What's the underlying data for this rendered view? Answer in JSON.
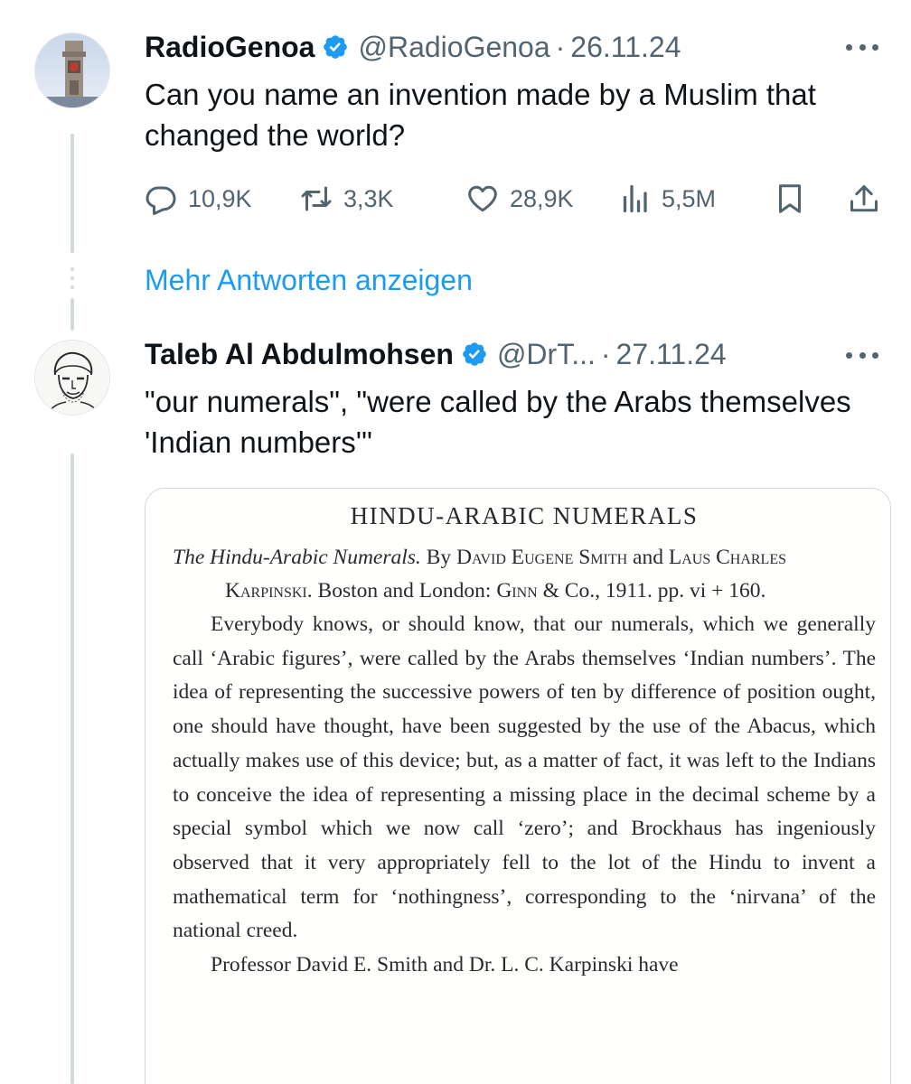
{
  "tweets": [
    {
      "name": "RadioGenoa",
      "handle": "@RadioGenoa",
      "separator": "·",
      "date": "26.11.24",
      "text": "Can you name an invention made by a Muslim that changed the world?",
      "stats": {
        "replies": "10,9K",
        "reposts": "3,3K",
        "likes": "28,9K",
        "views": "5,5M"
      }
    },
    {
      "name": "Taleb Al Abdulmohsen",
      "handle": "@DrT...",
      "separator": "·",
      "date": "27.11.24",
      "text": "\"our numerals\", \"were called by the Arabs themselves 'Indian numbers'\""
    }
  ],
  "more_replies_label": "Mehr Antworten anzeigen",
  "document": {
    "title": "HINDU-ARABIC NUMERALS",
    "ref_title": "The Hindu-Arabic Numerals.",
    "ref_by": "By",
    "ref_author1": "David Eugene Smith",
    "ref_and": "and",
    "ref_author2": "Laus Charles Karpinski.",
    "ref_place": "Boston and London:",
    "ref_publisher": "Ginn",
    "ref_rest": "& Co., 1911. pp. vi + 160.",
    "paragraph1": "Everybody knows, or should know, that our numerals, which we generally call ‘Arabic figures’, were called by the Arabs themselves ‘Indian numbers’. The idea of representing the successive powers of ten by difference of position ought, one should have thought, have been suggested by the use of the Abacus, which actually makes use of this device; but, as a matter of fact, it was left to the Indians to conceive the idea of representing a missing place in the decimal scheme by a special symbol which we now call ‘zero’; and Brockhaus has ingeniously observed that it very appropriately fell to the lot of the Hindu to invent a mathematical term for ‘nothingness’, corresponding to the ‘nirvana’ of the national creed.",
    "paragraph2": "Professor David E. Smith and Dr. L. C. Karpinski have"
  },
  "colors": {
    "accent": "#1d9bf0",
    "secondary_text": "#536471",
    "thread_line": "#cfd9de"
  },
  "icons": [
    "verified-badge-icon",
    "more-icon",
    "reply-icon",
    "repost-icon",
    "like-icon",
    "views-icon",
    "bookmark-icon",
    "share-icon"
  ]
}
